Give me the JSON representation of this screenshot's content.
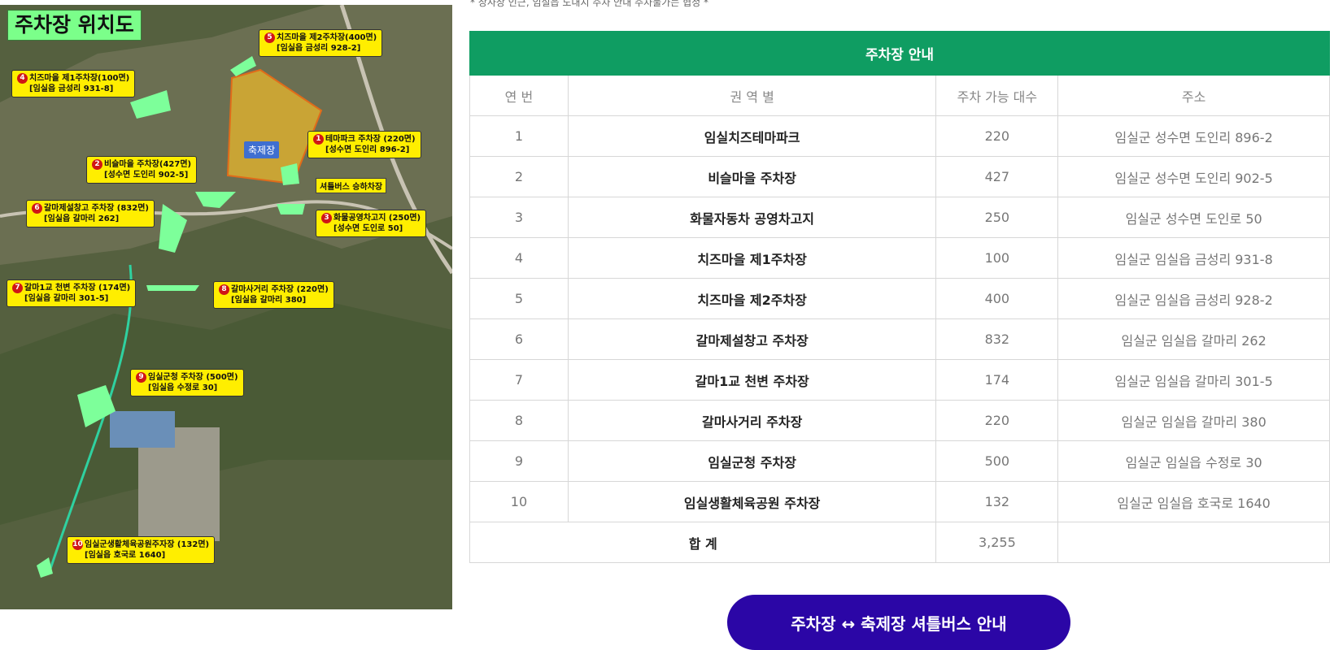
{
  "top_note": "* 장사장 인근, 임실읍 도내지 주차 안내 주차불가는 협정 *",
  "map": {
    "title": "주차장 위치도",
    "festival_label": "축제장",
    "shuttle_stop_label": "셔틀버스 승하차장",
    "callouts": [
      {
        "num": "1",
        "name": "테마파크 주차장 (220면)",
        "addr": "[성수면 도인리 896-2]"
      },
      {
        "num": "2",
        "name": "비슬마을 주차장(427면)",
        "addr": "[성수면 도인리 902-5]"
      },
      {
        "num": "3",
        "name": "화물공영차고지 (250면)",
        "addr": "[성수면 도인로 50]"
      },
      {
        "num": "4",
        "name": "치즈마을 제1주차장(100면)",
        "addr": "[임실읍 금성리 931-8]"
      },
      {
        "num": "5",
        "name": "치즈마을 제2주차장(400면)",
        "addr": "[임실읍 금성리 928-2]"
      },
      {
        "num": "6",
        "name": "갈마제설창고 주차장 (832면)",
        "addr": "[임실읍 갈마리 262]"
      },
      {
        "num": "7",
        "name": "갈마1교 천변 주차장 (174면)",
        "addr": "[임실읍 갈마리 301-5]"
      },
      {
        "num": "8",
        "name": "갈마사거리 주차장 (220면)",
        "addr": "[임실읍 갈마리 380]"
      },
      {
        "num": "9",
        "name": "임실군청 주차장 (500면)",
        "addr": "[임실읍 수정로 30]"
      },
      {
        "num": "10",
        "name": "임실군생활체육공원주자장 (132면)",
        "addr": "[임실읍 호국로 1640]"
      }
    ]
  },
  "table": {
    "title": "주차장 안내",
    "headers": [
      "연 번",
      "권 역 별",
      "주차 가능 대수",
      "주소"
    ],
    "rows": [
      {
        "no": "1",
        "name": "임실치즈테마파크",
        "count": "220",
        "address": "임실군 성수면 도인리 896-2"
      },
      {
        "no": "2",
        "name": "비슬마을 주차장",
        "count": "427",
        "address": "임실군 성수면 도인리 902-5"
      },
      {
        "no": "3",
        "name": "화물자동차 공영차고지",
        "count": "250",
        "address": "임실군 성수면 도인로 50"
      },
      {
        "no": "4",
        "name": "치즈마을 제1주차장",
        "count": "100",
        "address": "임실군 임실읍 금성리 931-8"
      },
      {
        "no": "5",
        "name": "치즈마을 제2주차장",
        "count": "400",
        "address": "임실군 임실읍 금성리 928-2"
      },
      {
        "no": "6",
        "name": "갈마제설창고 주차장",
        "count": "832",
        "address": "임실군 임실읍 갈마리 262"
      },
      {
        "no": "7",
        "name": "갈마1교 천변 주차장",
        "count": "174",
        "address": "임실군 임실읍 갈마리 301-5"
      },
      {
        "no": "8",
        "name": "갈마사거리 주차장",
        "count": "220",
        "address": "임실군 임실읍 갈마리 380"
      },
      {
        "no": "9",
        "name": "임실군청 주차장",
        "count": "500",
        "address": "임실군 임실읍 수정로 30"
      },
      {
        "no": "10",
        "name": "임실생활체육공원 주차장",
        "count": "132",
        "address": "임실군 임실읍 호국로 1640"
      }
    ],
    "total_label": "합 계",
    "total_value": "3,255"
  },
  "button": {
    "label": "주차장 ↔ 축제장 셔틀버스 안내"
  }
}
